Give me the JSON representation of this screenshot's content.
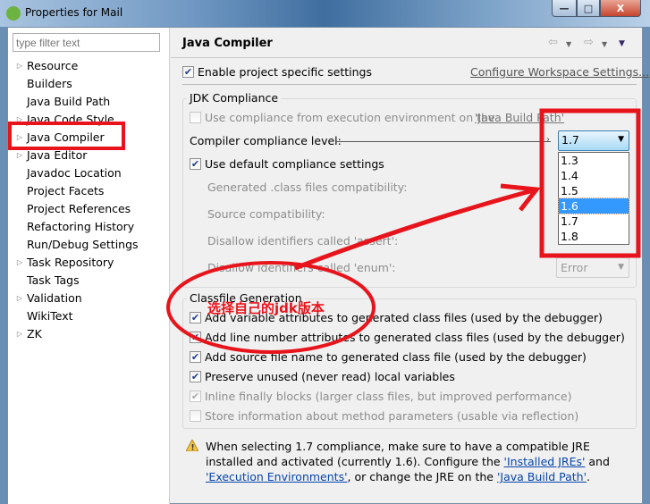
{
  "window": {
    "title": "Properties for Mail",
    "minimize": "—",
    "maximize": "□",
    "close": "X"
  },
  "filter": {
    "placeholder": "type filter text"
  },
  "tree": [
    {
      "label": "Resource",
      "expandable": true
    },
    {
      "label": "Builders",
      "expandable": false
    },
    {
      "label": "Java Build Path",
      "expandable": false
    },
    {
      "label": "Java Code Style",
      "expandable": true
    },
    {
      "label": "Java Compiler",
      "expandable": true,
      "selected": true
    },
    {
      "label": "Java Editor",
      "expandable": true
    },
    {
      "label": "Javadoc Location",
      "expandable": false
    },
    {
      "label": "Project Facets",
      "expandable": false
    },
    {
      "label": "Project References",
      "expandable": false
    },
    {
      "label": "Refactoring History",
      "expandable": false
    },
    {
      "label": "Run/Debug Settings",
      "expandable": false
    },
    {
      "label": "Task Repository",
      "expandable": true
    },
    {
      "label": "Task Tags",
      "expandable": false
    },
    {
      "label": "Validation",
      "expandable": true
    },
    {
      "label": "WikiText",
      "expandable": false
    },
    {
      "label": "ZK",
      "expandable": true
    }
  ],
  "page": {
    "title": "Java Compiler",
    "enable_specific": {
      "label": "Enable project specific settings",
      "checked": true
    },
    "configure_link": "Configure Workspace Settings...",
    "jdk": {
      "group_label": "JDK Compliance",
      "use_ee": {
        "label_prefix": "Use compliance from execution environment on the ",
        "link": "'Java Build Path'",
        "checked": false
      },
      "level_label": "Compiler compliance level:",
      "level_value": "1.7",
      "level_options": [
        "1.3",
        "1.4",
        "1.5",
        "1.6",
        "1.7",
        "1.8"
      ],
      "highlighted_option": "1.6",
      "use_default": {
        "label": "Use default compliance settings",
        "checked": true
      },
      "generated_label": "Generated .class files compatibility:",
      "source_label": "Source compatibility:",
      "assert_label": "Disallow identifiers called 'assert':",
      "enum_label": "Disallow identifiers called 'enum':",
      "enum_value": "Error"
    },
    "classfile": {
      "group_label": "Classfile Generation",
      "options": [
        {
          "label": "Add variable attributes to generated class files (used by the debugger)",
          "checked": true,
          "enabled": true
        },
        {
          "label": "Add line number attributes to generated class files (used by the debugger)",
          "checked": true,
          "enabled": true
        },
        {
          "label": "Add source file name to generated class file (used by the debugger)",
          "checked": true,
          "enabled": true
        },
        {
          "label": "Preserve unused (never read) local variables",
          "checked": true,
          "enabled": true
        },
        {
          "label": "Inline finally blocks (larger class files, but improved performance)",
          "checked": true,
          "enabled": false
        },
        {
          "label": "Store information about method parameters (usable via reflection)",
          "checked": false,
          "enabled": false
        }
      ]
    },
    "warning": {
      "t1": "When selecting 1.7 compliance, make sure to have a compatible JRE installed and activated (currently 1.6). Configure the ",
      "l1": "'Installed JREs'",
      "t2": " and ",
      "l2": "'Execution Environments'",
      "t3": ", or change the JRE on the ",
      "l3": "'Java Build Path'",
      "t4": "."
    }
  },
  "annotation": {
    "text": "选择自己的jdk版本",
    "color": "#e8141c"
  }
}
